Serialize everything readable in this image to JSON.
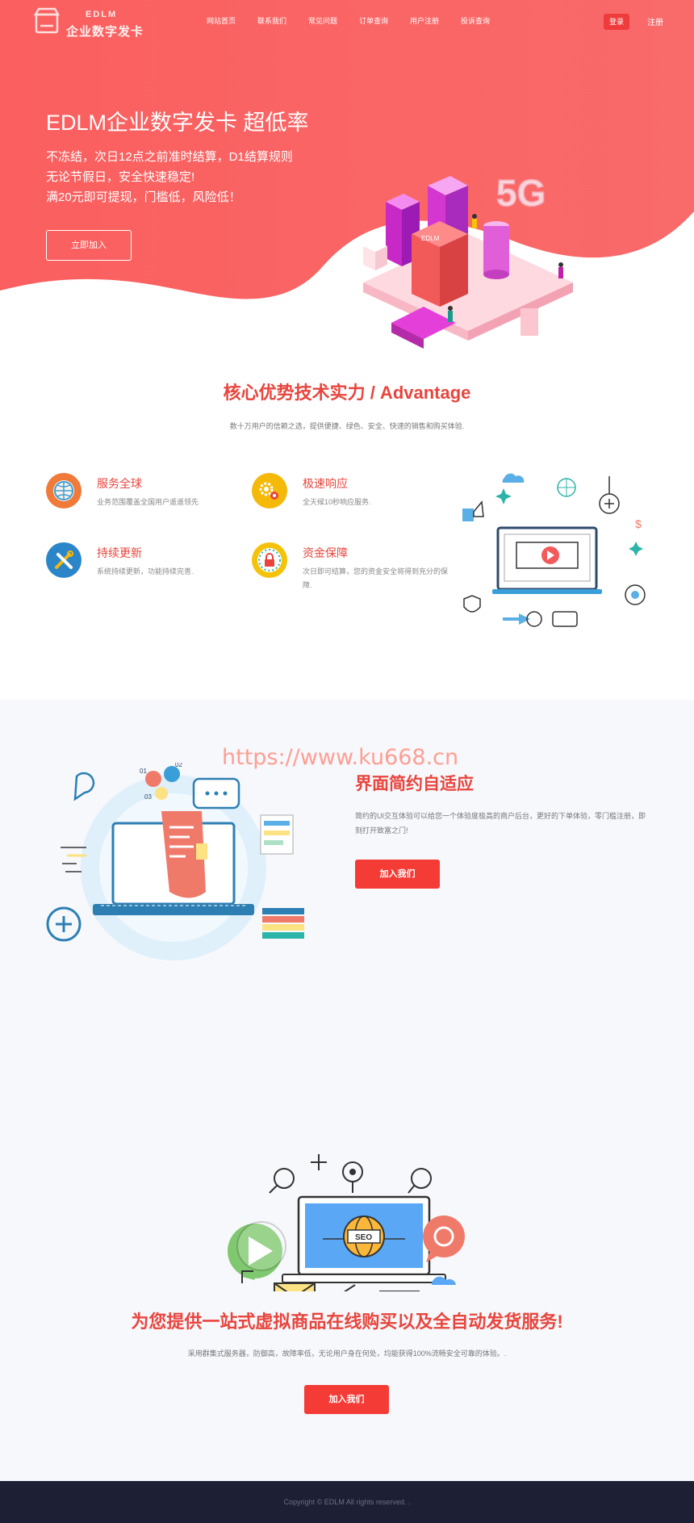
{
  "logo": {
    "en": "EDLM",
    "cn": "企业数字发卡"
  },
  "nav": {
    "items": [
      "网站首页",
      "联系我们",
      "常见问题",
      "订单查询",
      "用户注册",
      "投诉查询"
    ],
    "login": "登录",
    "register": "注册"
  },
  "hero": {
    "title": "EDLM企业数字发卡 超低率",
    "lines": [
      "不冻结，次日12点之前准时结算，D1结算规则",
      "无论节假日，安全快速稳定!",
      "满20元即可提现，门槛低，风险低！"
    ],
    "button": "立即加入"
  },
  "advantage": {
    "title": "核心优势技术实力 / Advantage",
    "subtitle": "数十万用户的信赖之选，提供便捷、绿色、安全、快速的销售和购买体验.",
    "features": [
      {
        "title": "服务全球",
        "desc": "业务范围覆盖全国用户遥遥领先",
        "icon": "globe-icon"
      },
      {
        "title": "极速响应",
        "desc": "全天候10秒响应服务.",
        "icon": "gears-icon"
      },
      {
        "title": "持续更新",
        "desc": "系统持续更新，功能持续完善.",
        "icon": "tools-icon"
      },
      {
        "title": "资金保障",
        "desc": "次日即可结算，您的资金安全将得到充分的保障.",
        "icon": "lock-icon"
      }
    ]
  },
  "watermark": "https://www.ku668.cn",
  "section2": {
    "title": "界面简约自适应",
    "desc": "简约的UI交互体验可以给您一个体验度极高的商户后台，更好的下单体验，零门槛注册，即刻打开致富之门!",
    "button": "加入我们",
    "illus_labels": [
      "01",
      "02",
      "03"
    ]
  },
  "section3": {
    "title": "为您提供一站式虚拟商品在线购买以及全自动发货服务!",
    "desc": "采用群集式服务器，防御高，故障率低，无论用户身在何处，均能获得100%流畅安全可靠的体验。.",
    "button": "加入我们",
    "seo_label": "SEO"
  },
  "footer": {
    "copyright": "Copyright © EDLM All rights reserved. ."
  },
  "colors": {
    "brand_red": "#f85d5d",
    "accent_red": "#e8453d",
    "button_red": "#f53b36",
    "footer_bg": "#1d2035",
    "section_bg": "#f7f8fc"
  }
}
